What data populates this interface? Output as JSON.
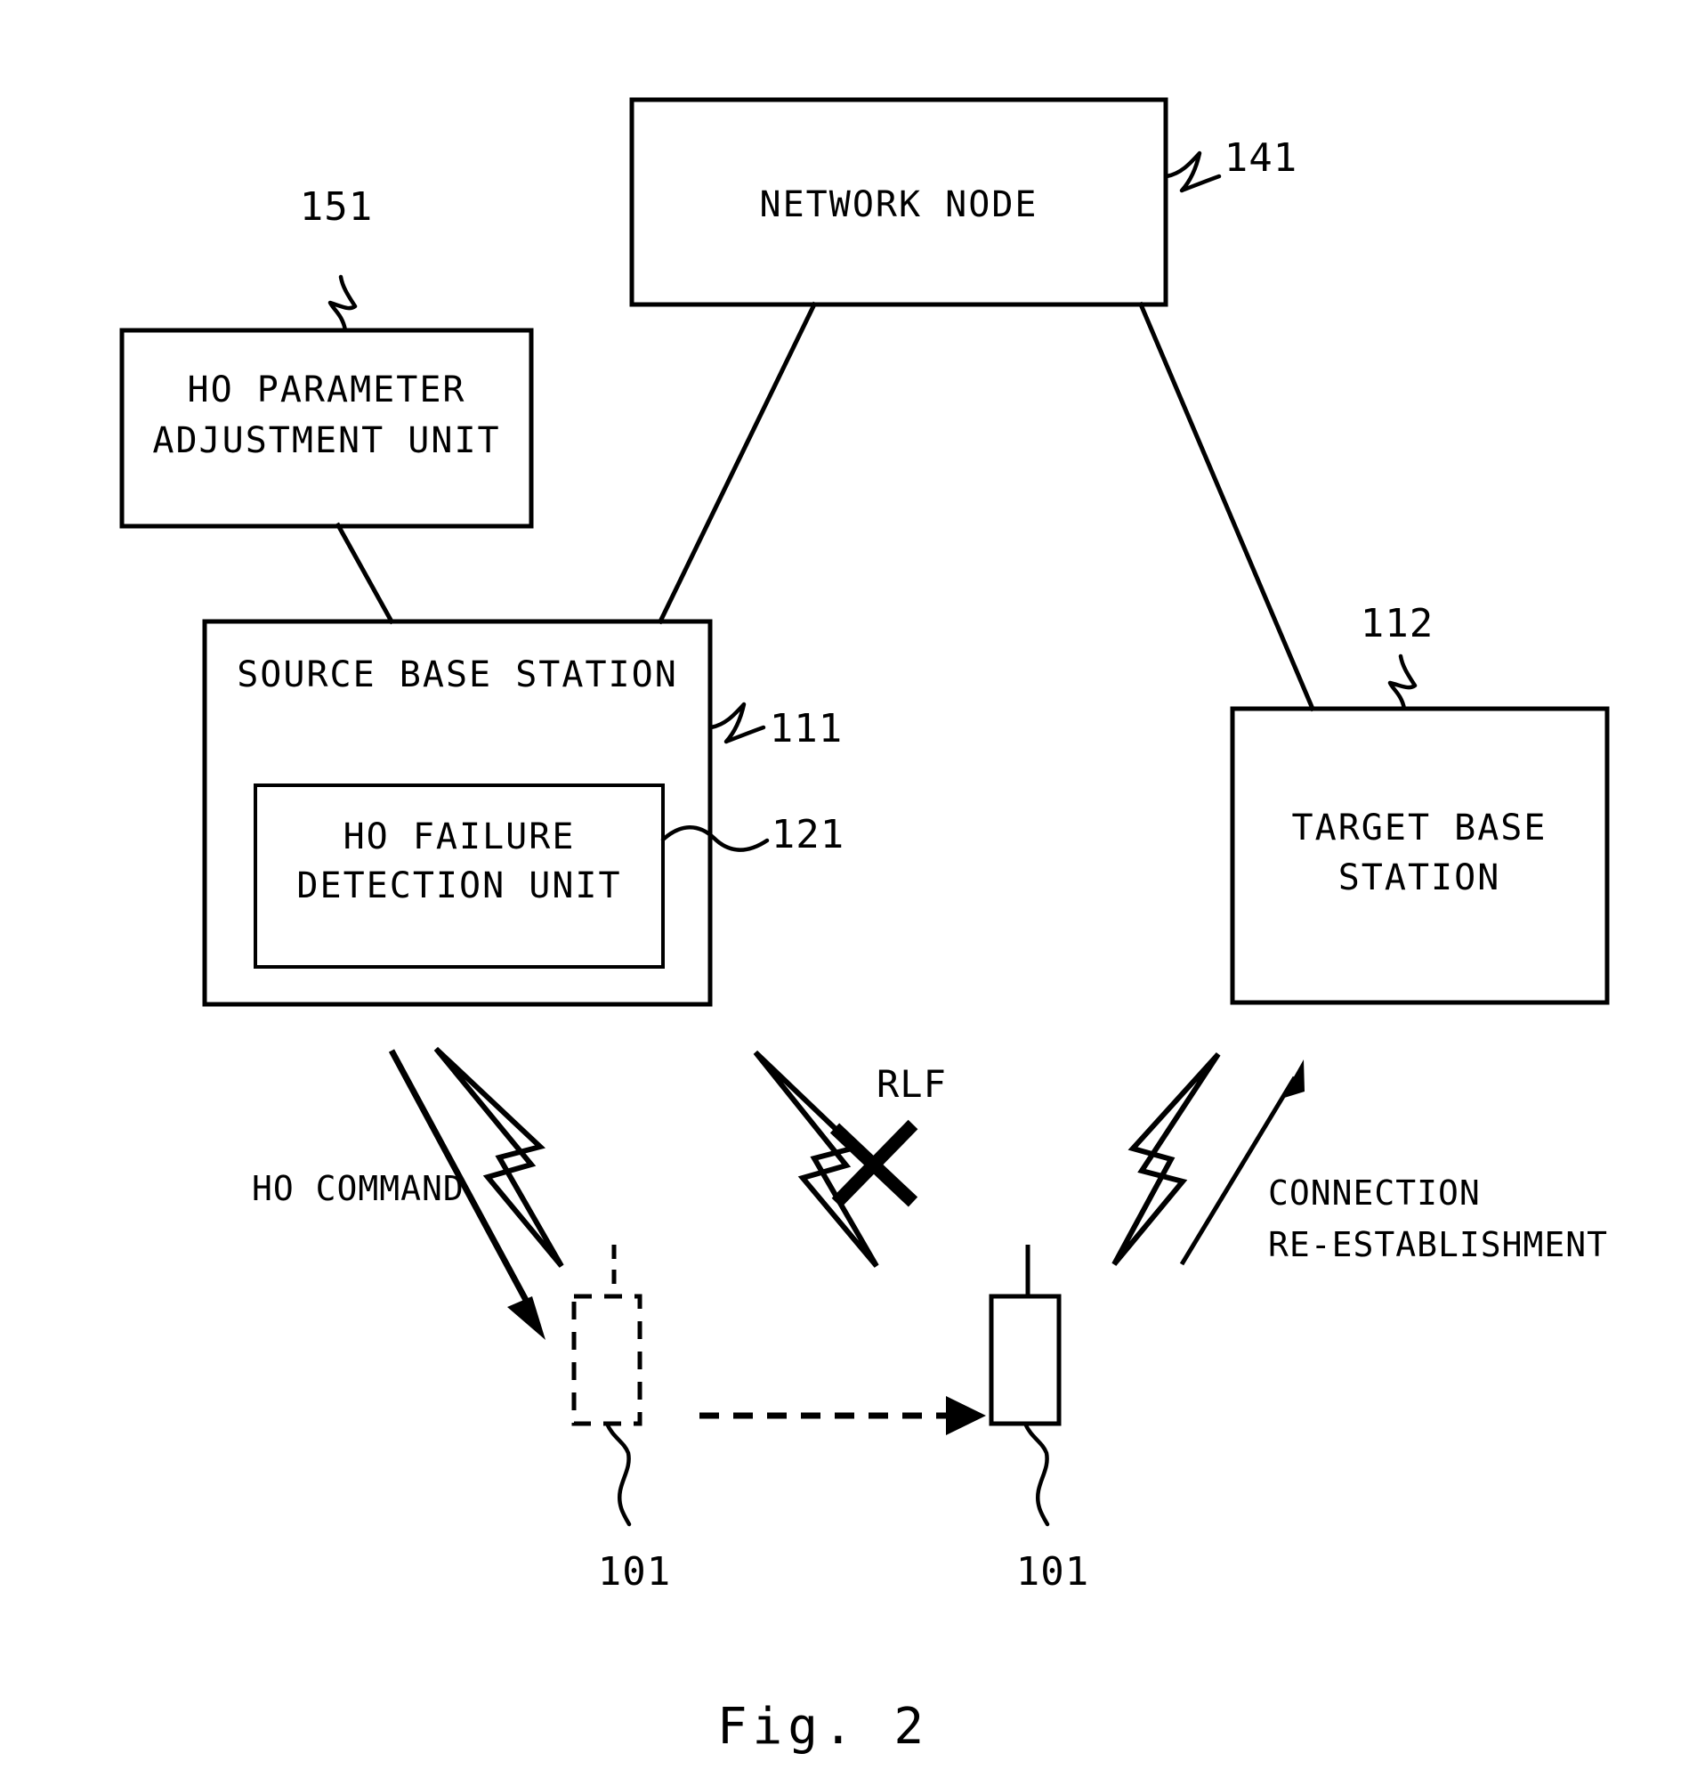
{
  "figure": {
    "caption": "Fig. 2",
    "type": "patent-block-diagram"
  },
  "blocks": {
    "network_node": {
      "label": "NETWORK NODE",
      "ref": "141"
    },
    "ho_parameter_adjustment_unit": {
      "label_line1": "HO PARAMETER",
      "label_line2": "ADJUSTMENT UNIT",
      "ref": "151"
    },
    "source_base_station": {
      "label": "SOURCE BASE STATION",
      "ref": "111"
    },
    "ho_failure_detection_unit": {
      "label_line1": "HO FAILURE",
      "label_line2": "DETECTION UNIT",
      "ref": "121"
    },
    "target_base_station": {
      "label_line1": "TARGET BASE",
      "label_line2": "STATION",
      "ref": "112"
    },
    "ue_before": {
      "ref": "101"
    },
    "ue_after": {
      "ref": "101"
    }
  },
  "annotations": {
    "ho_command": "HO COMMAND",
    "rlf": "RLF",
    "connection_reestablishment_line1": "CONNECTION",
    "connection_reestablishment_line2": "RE-ESTABLISHMENT"
  },
  "colors": {
    "ink": "#000000",
    "paper": "#ffffff"
  }
}
